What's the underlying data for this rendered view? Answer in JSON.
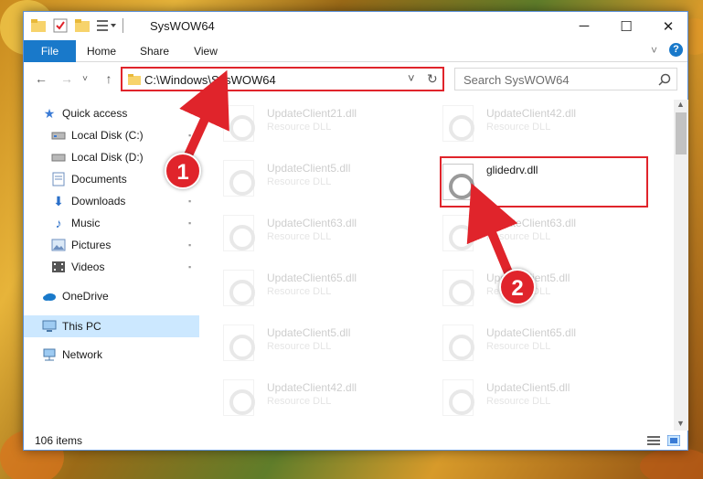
{
  "window": {
    "title": "SysWOW64",
    "controls": [
      "minimize-icon",
      "maximize-icon",
      "close-icon"
    ]
  },
  "ribbon": {
    "tabs": [
      "File",
      "Home",
      "Share",
      "View"
    ]
  },
  "address_bar": {
    "path": "C:\\Windows\\SysWOW64",
    "search_placeholder": "Search SysWOW64"
  },
  "sidebar": {
    "items": [
      {
        "label": "Quick access",
        "icon": "star-icon"
      },
      {
        "label": "Local Disk (C:)",
        "icon": "drive-icon"
      },
      {
        "label": "Local Disk (D:)",
        "icon": "drive-icon"
      },
      {
        "label": "Documents",
        "icon": "documents-icon"
      },
      {
        "label": "Downloads",
        "icon": "download-icon"
      },
      {
        "label": "Music",
        "icon": "music-icon"
      },
      {
        "label": "Pictures",
        "icon": "pictures-icon"
      },
      {
        "label": "Videos",
        "icon": "videos-icon"
      },
      {
        "label": "OneDrive",
        "icon": "cloud-icon"
      },
      {
        "label": "This PC",
        "icon": "computer-icon"
      },
      {
        "label": "Network",
        "icon": "network-icon"
      }
    ]
  },
  "files": {
    "left": [
      {
        "name": "UpdateClient21.dll",
        "type": "Resource DLL"
      },
      {
        "name": "UpdateClient5.dll",
        "type": "Resource DLL"
      },
      {
        "name": "UpdateClient63.dll",
        "type": "Resource DLL"
      },
      {
        "name": "UpdateClient65.dll",
        "type": "Resource DLL"
      },
      {
        "name": "UpdateClient5.dll",
        "type": "Resource DLL"
      },
      {
        "name": "UpdateClient42.dll",
        "type": "Resource DLL"
      }
    ],
    "right": [
      {
        "name": "UpdateClient42.dll",
        "type": "Resource DLL"
      },
      {
        "name": "glidedrv.dll",
        "type": ""
      },
      {
        "name": "UpdateClient63.dll",
        "type": "Resource DLL"
      },
      {
        "name": "UpdateClient5.dll",
        "type": "Resource DLL"
      },
      {
        "name": "UpdateClient65.dll",
        "type": "Resource DLL"
      },
      {
        "name": "UpdateClient5.dll",
        "type": "Resource DLL"
      }
    ]
  },
  "status": {
    "count": "106 items"
  },
  "annotations": {
    "step1": "1",
    "step2": "2",
    "highlight_color": "#e0242b"
  },
  "colors": {
    "accent": "#1979ca",
    "selection": "#cce8ff"
  }
}
